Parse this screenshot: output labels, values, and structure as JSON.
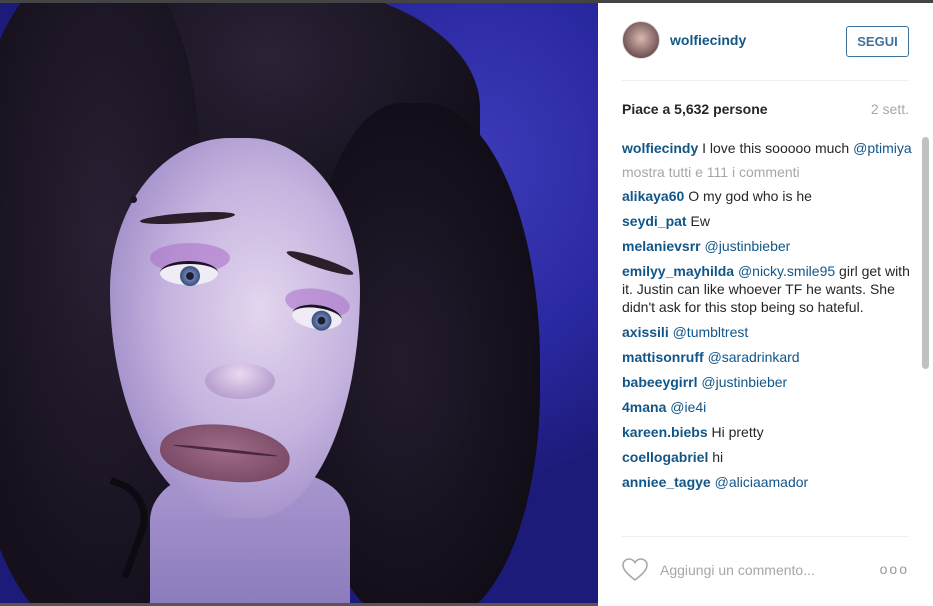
{
  "post": {
    "username": "wolfiecindy",
    "follow_label": "SEGUI",
    "likes_text": "Piace a 5,632 persone",
    "time_ago": "2 sett."
  },
  "caption": {
    "user": "wolfiecindy",
    "text": "I love this sooooo much",
    "mention": "@ptimiya"
  },
  "show_all_comments": "mostra tutti e 111 i commenti",
  "comments": [
    {
      "user": "alikaya60",
      "text": "O my god who is he",
      "mention": ""
    },
    {
      "user": "seydi_pat",
      "text": "Ew",
      "mention": ""
    },
    {
      "user": "melanievsrr",
      "text": "",
      "mention": "@justinbieber"
    },
    {
      "user": "emilyy_mayhilda",
      "mention": "@nicky.smile95",
      "text": "girl get with it. Justin can like whoever TF he wants. She didn't ask for this stop being so hateful."
    },
    {
      "user": "axissili",
      "text": "",
      "mention": "@tumbltrest"
    },
    {
      "user": "mattisonruff",
      "text": "",
      "mention": "@saradrinkard"
    },
    {
      "user": "babeeygirrl",
      "text": "",
      "mention": "@justinbieber"
    },
    {
      "user": "4mana",
      "text": "",
      "mention": "@ie4i"
    },
    {
      "user": "kareen.biebs",
      "text": "Hi pretty",
      "mention": ""
    },
    {
      "user": "coellogabriel",
      "text": "hi",
      "mention": ""
    },
    {
      "user": "anniee_tagye",
      "text": "",
      "mention": "@aliciaamador"
    }
  ],
  "footer": {
    "comment_placeholder": "Aggiungi un commento...",
    "options_label": "ooo",
    "like_icon": "heart-icon"
  },
  "colors": {
    "username_blue": "#125688",
    "button_blue": "#3f729b",
    "muted_gray": "#a5a7aa",
    "text": "#262626"
  }
}
